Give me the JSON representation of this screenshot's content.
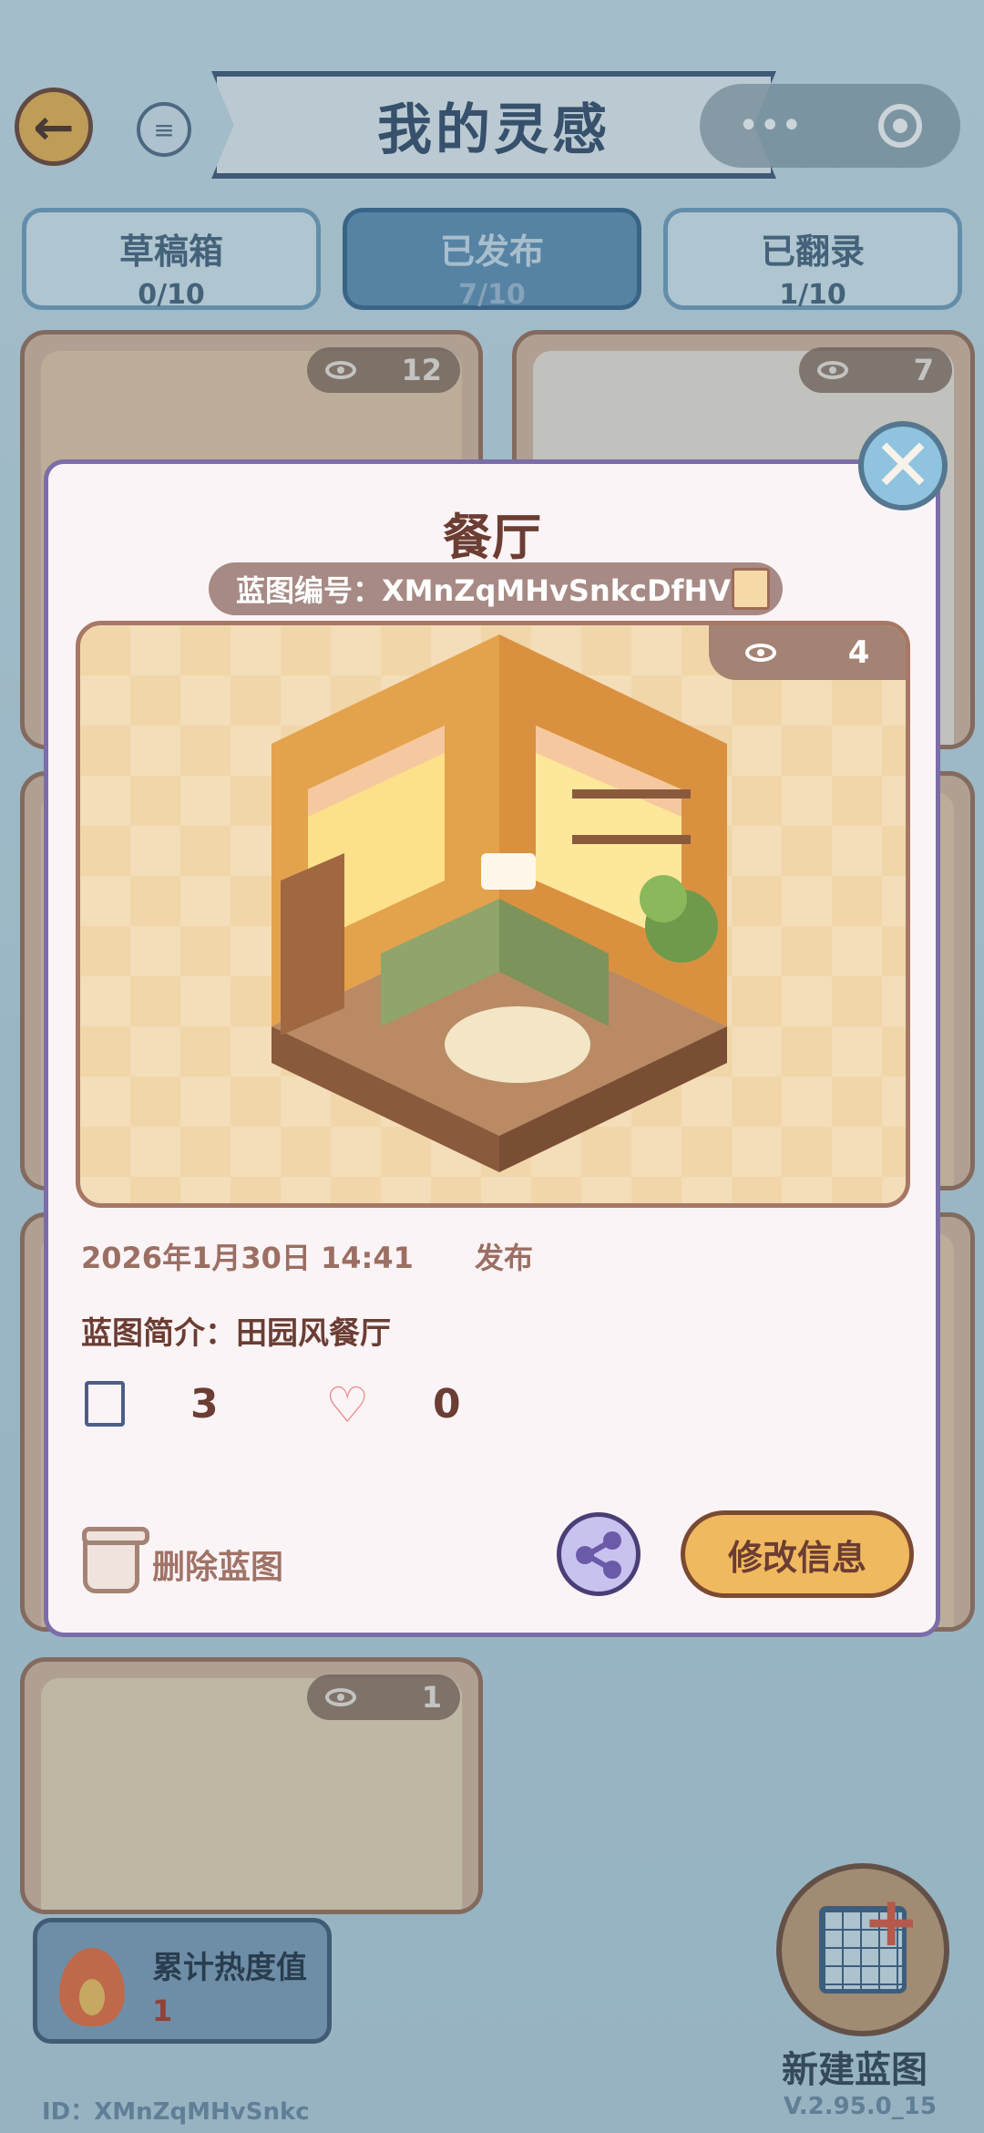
{
  "header": {
    "title": "我的灵感",
    "back_icon": "←",
    "more_icon": "•••"
  },
  "tabs": [
    {
      "label": "草稿箱",
      "count": "0/10",
      "active": false
    },
    {
      "label": "已发布",
      "count": "7/10",
      "active": true
    },
    {
      "label": "已翻录",
      "count": "1/10",
      "active": false
    }
  ],
  "cards": [
    {
      "views": "12"
    },
    {
      "views": "7"
    },
    {
      "views": "1"
    }
  ],
  "modal": {
    "title": "餐厅",
    "blueprint_id_label": "蓝图编号：XMnZqMHvSnkcDfHV",
    "preview_views": "4",
    "publish_time": "2026年1月30日 14:41",
    "publish_label": "发布",
    "description": "蓝图简介：田园风餐厅",
    "copies": "3",
    "likes": "0",
    "delete_label": "删除蓝图",
    "edit_label": "修改信息",
    "close_icon": "✕"
  },
  "footer": {
    "heat_label": "累计热度值",
    "heat_value": "1",
    "new_blueprint_label": "新建蓝图",
    "user_id": "ID：XMnZqMHvSnkc",
    "version": "V.2.95.0_15"
  },
  "colors": {
    "modal_border": "#7b6da8",
    "edit_button": "#f1b95f",
    "active_tab": "#5d8fb6",
    "title_text": "#6b3d33"
  }
}
